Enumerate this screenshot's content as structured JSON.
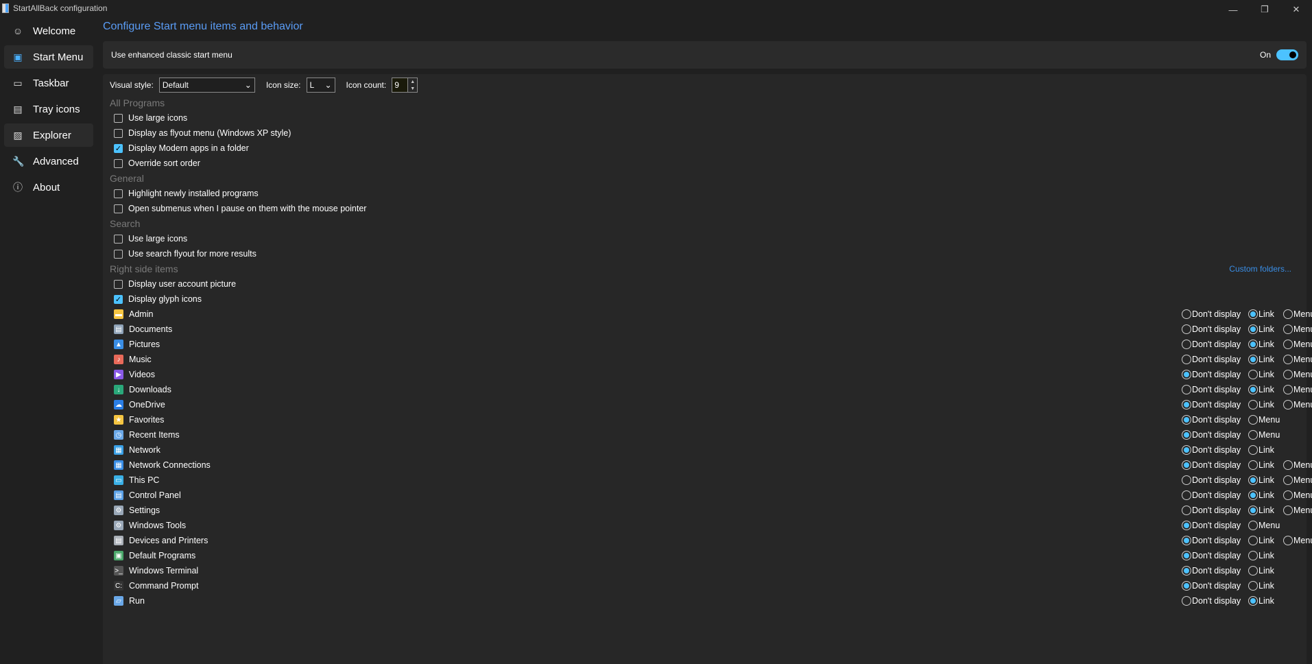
{
  "window": {
    "title": "StartAllBack configuration",
    "minimize": "—",
    "restore": "❐",
    "close": "✕"
  },
  "sidebar": [
    {
      "label": "Welcome",
      "icon": "smile-icon",
      "glyph": "☺"
    },
    {
      "label": "Start Menu",
      "icon": "start-menu-icon",
      "glyph": "▣"
    },
    {
      "label": "Taskbar",
      "icon": "taskbar-icon",
      "glyph": "▭"
    },
    {
      "label": "Tray icons",
      "icon": "tray-icon",
      "glyph": "▤"
    },
    {
      "label": "Explorer",
      "icon": "explorer-icon",
      "glyph": "▨"
    },
    {
      "label": "Advanced",
      "icon": "wrench-icon",
      "glyph": "🔧"
    },
    {
      "label": "About",
      "icon": "info-icon",
      "glyph": "ⓘ"
    }
  ],
  "page": {
    "heading": "Configure Start menu items and behavior",
    "enhanced_label": "Use enhanced classic start menu",
    "enhanced_state": "On"
  },
  "options": {
    "visual_style_label": "Visual style:",
    "visual_style": "Default",
    "icon_size_label": "Icon size:",
    "icon_size": "L",
    "icon_count_label": "Icon count:",
    "icon_count": "9"
  },
  "sections": [
    {
      "title": "All Programs",
      "items": [
        {
          "label": "Use large icons",
          "checked": false
        },
        {
          "label": "Display as flyout menu (Windows XP style)",
          "checked": false
        },
        {
          "label": "Display Modern apps in a folder",
          "checked": true
        },
        {
          "label": "Override sort order",
          "checked": false
        }
      ]
    },
    {
      "title": "General",
      "items": [
        {
          "label": "Highlight newly installed programs",
          "checked": false
        },
        {
          "label": "Open submenus when I pause on them with the mouse pointer",
          "checked": false
        }
      ]
    },
    {
      "title": "Search",
      "items": [
        {
          "label": "Use large icons",
          "checked": false
        },
        {
          "label": "Use search flyout for more results",
          "checked": false
        }
      ]
    },
    {
      "title": "Right side items",
      "link": "Custom folders...",
      "items": [
        {
          "label": "Display user account picture",
          "checked": false
        },
        {
          "label": "Display glyph icons",
          "checked": true
        }
      ]
    }
  ],
  "right_items": [
    {
      "label": "Admin",
      "color": "#f5c542",
      "glyph": "▬",
      "options": [
        "Don't display",
        "Link",
        "Menu"
      ],
      "selected": 1
    },
    {
      "label": "Documents",
      "color": "#8fa3b8",
      "glyph": "▤",
      "options": [
        "Don't display",
        "Link",
        "Menu"
      ],
      "selected": 1
    },
    {
      "label": "Pictures",
      "color": "#3a8ee6",
      "glyph": "▲",
      "options": [
        "Don't display",
        "Link",
        "Menu"
      ],
      "selected": 1
    },
    {
      "label": "Music",
      "color": "#e86a5a",
      "glyph": "♪",
      "options": [
        "Don't display",
        "Link",
        "Menu"
      ],
      "selected": 1
    },
    {
      "label": "Videos",
      "color": "#8a5ae8",
      "glyph": "▶",
      "options": [
        "Don't display",
        "Link",
        "Menu"
      ],
      "selected": 0
    },
    {
      "label": "Downloads",
      "color": "#2aa87a",
      "glyph": "↓",
      "options": [
        "Don't display",
        "Link",
        "Menu"
      ],
      "selected": 1
    },
    {
      "label": "OneDrive",
      "color": "#2a7ee6",
      "glyph": "☁",
      "options": [
        "Don't display",
        "Link",
        "Menu"
      ],
      "selected": 0
    },
    {
      "label": "Favorites",
      "color": "#f5c542",
      "glyph": "★",
      "options": [
        "Don't display",
        "Menu"
      ],
      "selected": 0
    },
    {
      "label": "Recent Items",
      "color": "#6aa8e8",
      "glyph": "◷",
      "options": [
        "Don't display",
        "Menu"
      ],
      "selected": 0
    },
    {
      "label": "Network",
      "color": "#3aa0e6",
      "glyph": "▦",
      "options": [
        "Don't display",
        "Link"
      ],
      "selected": 0
    },
    {
      "label": "Network Connections",
      "color": "#3a8ee6",
      "glyph": "▦",
      "options": [
        "Don't display",
        "Link",
        "Menu"
      ],
      "selected": 0
    },
    {
      "label": "This PC",
      "color": "#3ab0e6",
      "glyph": "▭",
      "options": [
        "Don't display",
        "Link",
        "Menu"
      ],
      "selected": 1
    },
    {
      "label": "Control Panel",
      "color": "#5aa0e6",
      "glyph": "▤",
      "options": [
        "Don't display",
        "Link",
        "Menu"
      ],
      "selected": 1
    },
    {
      "label": "Settings",
      "color": "#9aa8b8",
      "glyph": "⚙",
      "options": [
        "Don't display",
        "Link",
        "Menu"
      ],
      "selected": 1
    },
    {
      "label": "Windows Tools",
      "color": "#9aa8b8",
      "glyph": "⚙",
      "options": [
        "Don't display",
        "Menu"
      ],
      "selected": 0
    },
    {
      "label": "Devices and Printers",
      "color": "#aab0b8",
      "glyph": "▤",
      "options": [
        "Don't display",
        "Link",
        "Menu"
      ],
      "selected": 0
    },
    {
      "label": "Default Programs",
      "color": "#4aa86a",
      "glyph": "▣",
      "options": [
        "Don't display",
        "Link"
      ],
      "selected": 0
    },
    {
      "label": "Windows Terminal",
      "color": "#555555",
      "glyph": ">_",
      "options": [
        "Don't display",
        "Link"
      ],
      "selected": 0
    },
    {
      "label": "Command Prompt",
      "color": "#333333",
      "glyph": "C:",
      "options": [
        "Don't display",
        "Link"
      ],
      "selected": 0
    },
    {
      "label": "Run",
      "color": "#6aa8e8",
      "glyph": "▱",
      "options": [
        "Don't display",
        "Link"
      ],
      "selected": 1
    }
  ]
}
